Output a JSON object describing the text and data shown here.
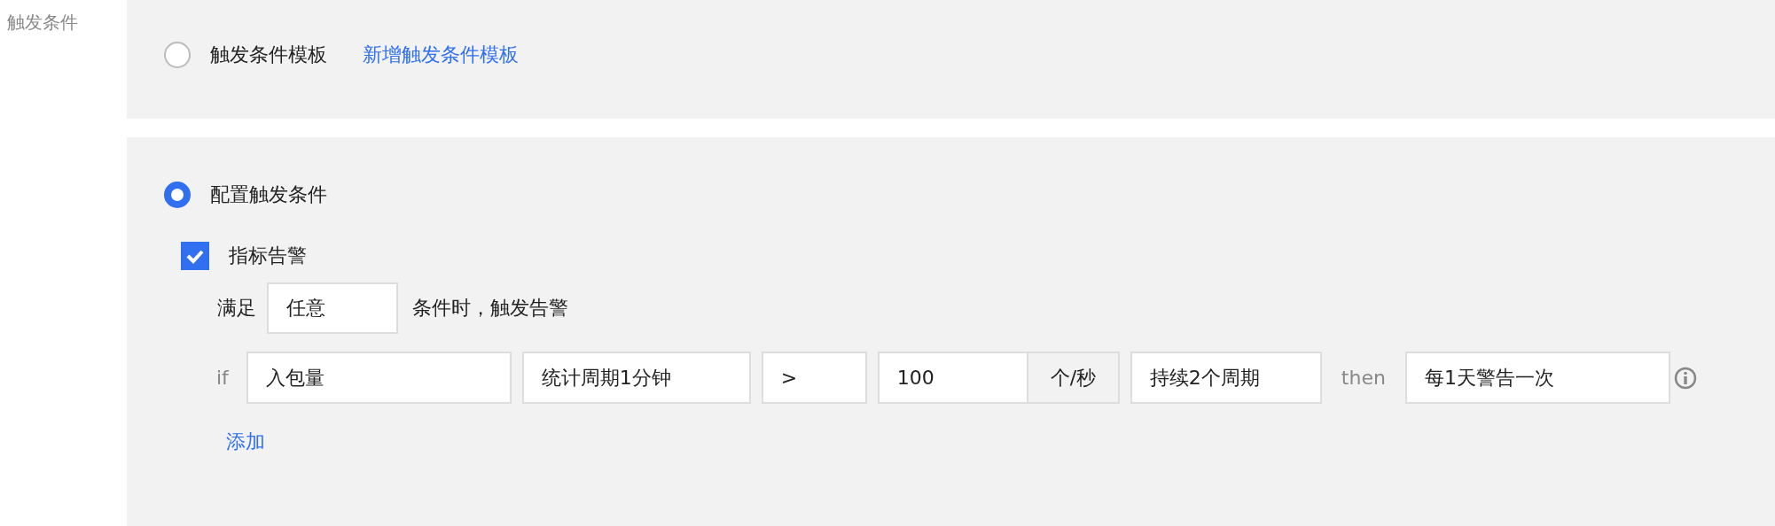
{
  "section_label": "触发条件",
  "options": [
    {
      "label": "触发条件模板",
      "selected": false,
      "link": "新增触发条件模板"
    },
    {
      "label": "配置触发条件",
      "selected": true
    }
  ],
  "metric_alarm": {
    "label": "指标告警",
    "checked": true,
    "prefix": "满足",
    "match": "任意",
    "suffix": "条件时，触发告警"
  },
  "condition": {
    "if_label": "if",
    "metric": "入包量",
    "period": "统计周期1分钟",
    "operator": ">",
    "threshold": "100",
    "unit": "个/秒",
    "duration": "持续2个周期",
    "then_label": "then",
    "frequency": "每1天警告一次"
  },
  "add_link": "添加"
}
